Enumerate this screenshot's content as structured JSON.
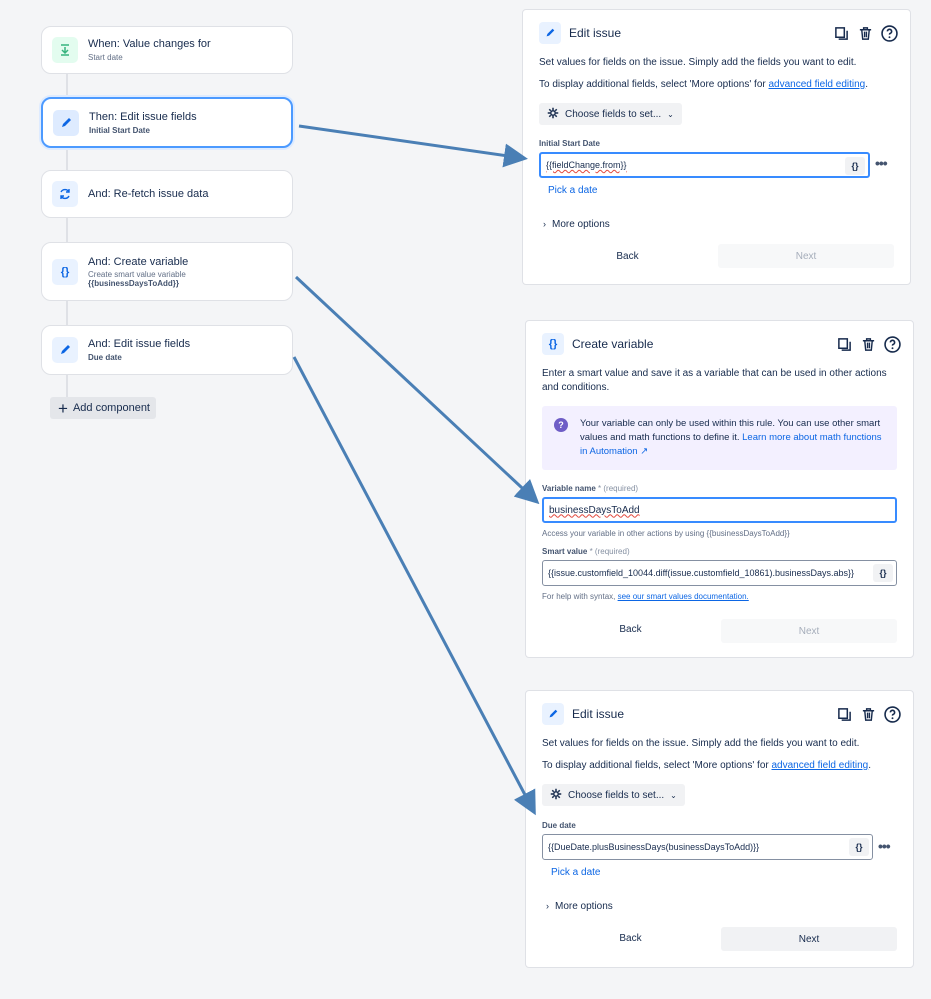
{
  "flow": {
    "nodes": [
      {
        "title": "When: Value changes for",
        "sub": "Start date"
      },
      {
        "title": "Then: Edit issue fields",
        "sub": "Initial Start Date"
      },
      {
        "title": "And: Re-fetch issue data"
      },
      {
        "title": "And: Create variable",
        "sub": "Create smart value variable",
        "sub2": "{{businessDaysToAdd}}"
      },
      {
        "title": "And: Edit issue fields",
        "sub": "Due date"
      }
    ],
    "add_component": "Add component"
  },
  "panel1": {
    "title": "Edit issue",
    "desc": "Set values for fields on the issue. Simply add the fields you want to edit.",
    "more_prefix": "To display additional fields, select 'More options' for ",
    "more_link": "advanced field editing",
    "more_suffix": ".",
    "choose": "Choose fields to set...",
    "field_label": "Initial Start Date",
    "field_value": "{{fieldChange.from}}",
    "braces": "{}",
    "pick_date": "Pick a date",
    "more_options": "More options",
    "back": "Back",
    "next": "Next"
  },
  "panel2": {
    "title": "Create variable",
    "desc": "Enter a smart value and save it as a variable that can be used in other actions and conditions.",
    "help_text": "Your variable can only be used within this rule. You can use other smart values and math functions to define it. ",
    "help_link": "Learn more about math functions in Automation ↗",
    "name_label": "Variable name",
    "name_req": "* (required)",
    "name_value": "businessDaysToAdd",
    "name_hint": "Access your variable in other actions by using {{businessDaysToAdd}}",
    "smart_label": "Smart value",
    "smart_req": "* (required)",
    "smart_value": "{{issue.customfield_10044.diff(issue.customfield_10861).businessDays.abs}}",
    "braces": "{}",
    "syntax_prefix": "For help with syntax, ",
    "syntax_link": "see our smart values documentation.",
    "back": "Back",
    "next": "Next"
  },
  "panel3": {
    "title": "Edit issue",
    "desc": "Set values for fields on the issue. Simply add the fields you want to edit.",
    "more_prefix": "To display additional fields, select 'More options' for ",
    "more_link": "advanced field editing",
    "more_suffix": ".",
    "choose": "Choose fields to set...",
    "field_label": "Due date",
    "field_value": "{{DueDate.plusBusinessDays(businessDaysToAdd)}}",
    "braces": "{}",
    "pick_date": "Pick a date",
    "more_options": "More options",
    "back": "Back",
    "next": "Next"
  },
  "colors": {
    "arrow": "#4a7fb5",
    "accent": "#0c66e4",
    "selected_border": "#4c9aff"
  },
  "icons": [
    "download-icon",
    "pencil-icon",
    "refresh-icon",
    "braces-icon",
    "copy-icon",
    "trash-icon",
    "help-icon",
    "gear-icon",
    "chevron-down-icon",
    "chevron-right-icon",
    "more-icon",
    "plus-icon"
  ]
}
